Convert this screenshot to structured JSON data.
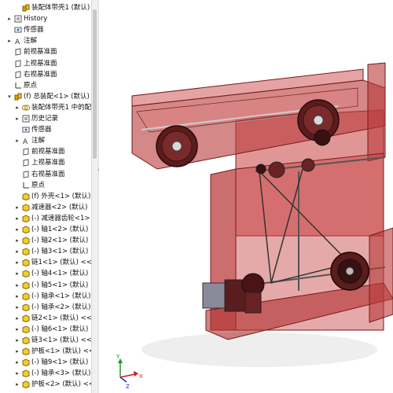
{
  "tree": {
    "items": [
      {
        "label": "装配体带壳1 (默认) <默认_显",
        "arrow": "",
        "icon": "assembly-icon"
      },
      {
        "label": "History",
        "arrow": "▸",
        "icon": "history-icon"
      },
      {
        "label": "传感器",
        "arrow": "",
        "icon": "sensor-icon"
      },
      {
        "label": "注解",
        "arrow": "▸",
        "icon": "annotation-icon"
      },
      {
        "label": "前视基准面",
        "arrow": "",
        "icon": "plane-icon"
      },
      {
        "label": "上视基准面",
        "arrow": "",
        "icon": "plane-icon"
      },
      {
        "label": "右视基准面",
        "arrow": "",
        "icon": "plane-icon"
      },
      {
        "label": "原点",
        "arrow": "",
        "icon": "origin-icon"
      },
      {
        "label": "(f) 总装配<1> (默认) <默",
        "arrow": "▾",
        "icon": "subassembly-icon"
      },
      {
        "label": "装配体带壳1 中的配",
        "arrow": "▸",
        "icon": "mates-icon"
      },
      {
        "label": "历史记录",
        "arrow": "▸",
        "icon": "history-icon"
      },
      {
        "label": "传感器",
        "arrow": "",
        "icon": "sensor-icon"
      },
      {
        "label": "注解",
        "arrow": "▸",
        "icon": "annotation-icon"
      },
      {
        "label": "前视基准面",
        "arrow": "",
        "icon": "plane-icon"
      },
      {
        "label": "上视基准面",
        "arrow": "",
        "icon": "plane-icon"
      },
      {
        "label": "右视基准面",
        "arrow": "",
        "icon": "plane-icon"
      },
      {
        "label": "原点",
        "arrow": "",
        "icon": "origin-icon"
      },
      {
        "label": "(f) 外壳<1> (默认)",
        "arrow": "",
        "icon": "part-icon"
      },
      {
        "label": "减速器<2> (默认)",
        "arrow": "▸",
        "icon": "part-icon"
      },
      {
        "label": "(-) 减速器齿轮<1>",
        "arrow": "▸",
        "icon": "part-icon"
      },
      {
        "label": "(-) 轴1<2> (默认)",
        "arrow": "▸",
        "icon": "part-icon"
      },
      {
        "label": "(-) 轴2<1> (默认)",
        "arrow": "▸",
        "icon": "part-icon"
      },
      {
        "label": "(-) 轴3<1> (默认)",
        "arrow": "▸",
        "icon": "part-icon"
      },
      {
        "label": "链1<1> (默认) <<",
        "arrow": "▸",
        "icon": "part-icon"
      },
      {
        "label": "(-) 轴4<1> (默认)",
        "arrow": "▸",
        "icon": "part-icon"
      },
      {
        "label": "(-) 轴5<1> (默认)",
        "arrow": "▸",
        "icon": "part-icon"
      },
      {
        "label": "(-) 轴承<1> (默认)",
        "arrow": "▸",
        "icon": "part-icon"
      },
      {
        "label": "(-) 轴承<2> (默认)",
        "arrow": "▸",
        "icon": "part-icon"
      },
      {
        "label": "链2<1> (默认) <<",
        "arrow": "▸",
        "icon": "part-icon"
      },
      {
        "label": "(-) 轴6<1> (默认)",
        "arrow": "▸",
        "icon": "part-icon"
      },
      {
        "label": "链3<1> (默认) <<",
        "arrow": "▸",
        "icon": "part-icon"
      },
      {
        "label": "护板<1> (默认) <<",
        "arrow": "▸",
        "icon": "part-icon"
      },
      {
        "label": "(-) 轴9<1> (默认)",
        "arrow": "▸",
        "icon": "part-icon"
      },
      {
        "label": "(-) 轴承<3> (默认)",
        "arrow": "▸",
        "icon": "part-icon"
      },
      {
        "label": "护板<2> (默认) <<",
        "arrow": "▸",
        "icon": "part-icon"
      }
    ]
  },
  "triad": {
    "x": "X",
    "y": "Y",
    "z": "Z"
  },
  "colors": {
    "body": "#b02a2a",
    "bodyFill": "#c84040",
    "gear": "#6a2222",
    "triadX": "#d01818",
    "triadY": "#1a9a1a",
    "triadZ": "#1a2ad0"
  }
}
